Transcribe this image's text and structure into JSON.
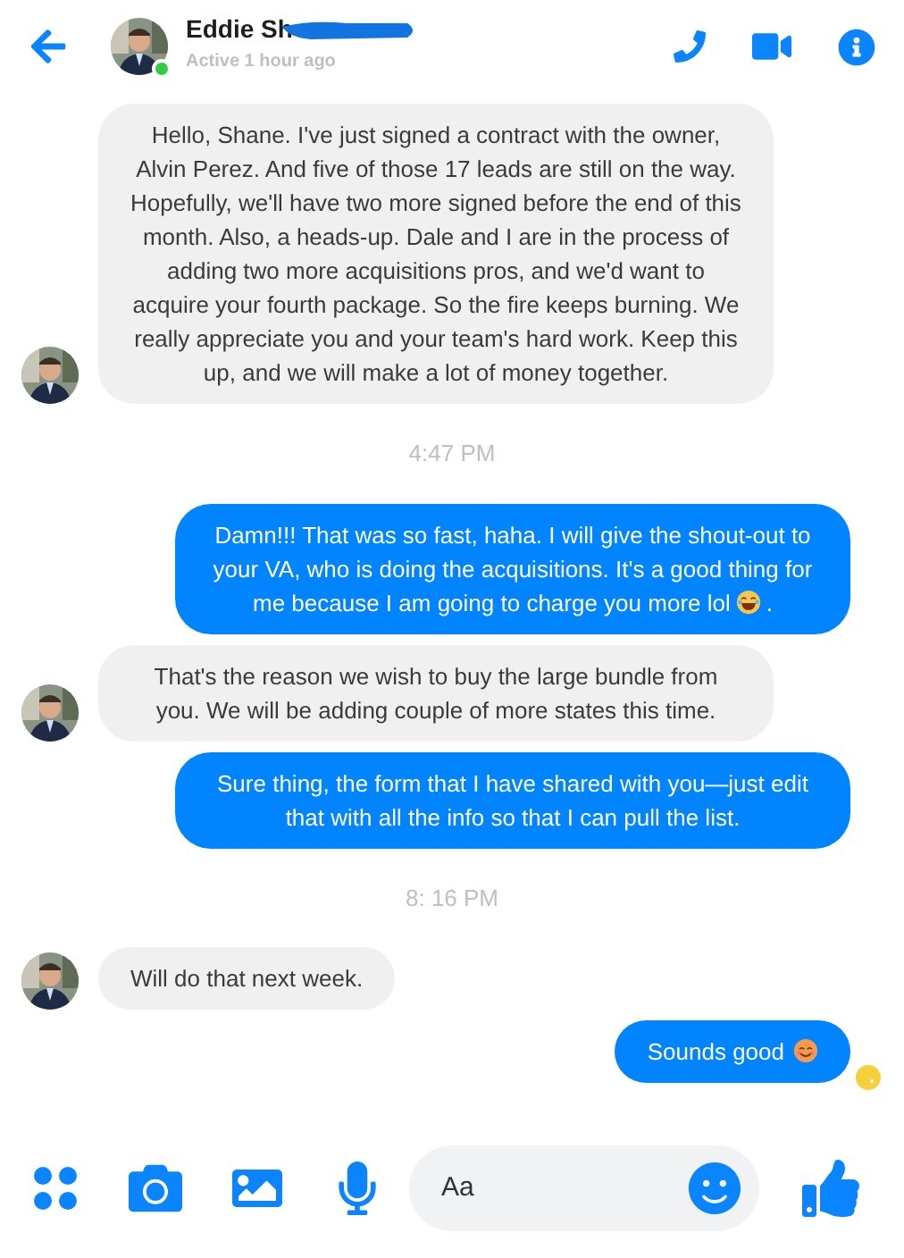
{
  "header": {
    "title": "Eddie Sh",
    "status": "Active 1 hour ago",
    "online": true
  },
  "items": [
    {
      "kind": "message",
      "outgoing": false,
      "text": "Hello, Shane. I've just signed a contract with the owner, Alvin Perez. And five of those 17 leads are still on the way. Hopefully, we'll have two more signed before the end of this month. Also, a heads-up. Dale and I are in the process of adding two more acquisitions pros, and we'd want to acquire your fourth package. So the fire keeps burning. We really appreciate you and your team's hard work. Keep this up, and we will make a lot of money together."
    },
    {
      "kind": "time",
      "text": "4:47 PM"
    },
    {
      "kind": "message",
      "outgoing": true,
      "text": "Damn!!! That was so fast, haha. I will give the shout-out to your VA, who is doing the acquisitions. It's a good thing for me because I am going to charge you more lol",
      "emoji": {
        "kind": "laugh"
      },
      "tail": "."
    },
    {
      "kind": "message",
      "outgoing": false,
      "text": "That's the reason we wish to buy the large bundle from you. We will be adding couple of more states this time."
    },
    {
      "kind": "message",
      "outgoing": true,
      "text": "Sure thing, the form that I have shared with you—just edit that with all the info so that I can pull the list."
    },
    {
      "kind": "time",
      "text": "8: 16 PM"
    },
    {
      "kind": "message",
      "outgoing": false,
      "text": "Will do that next week."
    },
    {
      "kind": "message",
      "outgoing": true,
      "text": "Sounds good",
      "emoji": {
        "kind": "smile"
      },
      "seen": true
    }
  ],
  "composer": {
    "placeholder": "Aa"
  }
}
